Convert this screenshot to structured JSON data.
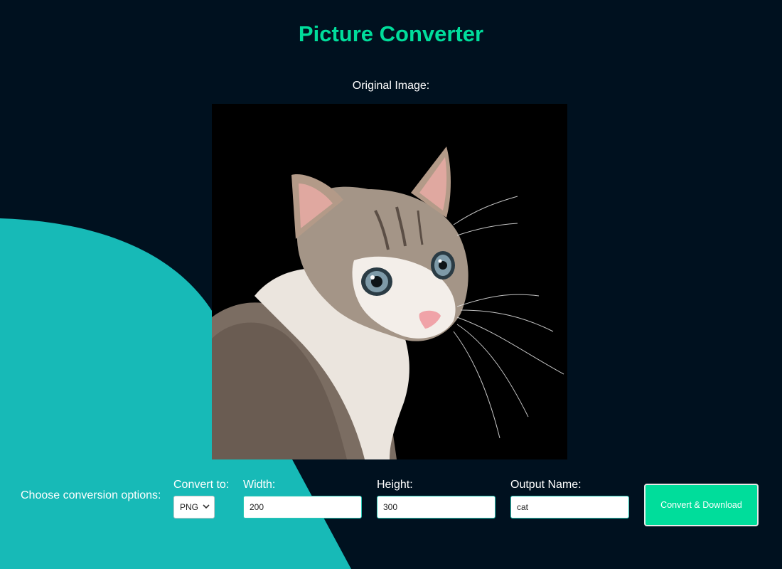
{
  "app": {
    "title": "Picture Converter"
  },
  "preview": {
    "label": "Original Image:",
    "image_description_icon": "cat-photo"
  },
  "options": {
    "label": "Choose conversion options:",
    "format": {
      "label": "Convert to:",
      "selected": "PNG"
    },
    "width": {
      "label": "Width:",
      "value": "200"
    },
    "height": {
      "label": "Height:",
      "value": "300"
    },
    "output_name": {
      "label": "Output Name:",
      "value": "cat"
    },
    "submit_label": "Convert & Download"
  },
  "colors": {
    "background": "#00111f",
    "accent": "#00dd9b",
    "teal_shape": "#17bab7"
  }
}
